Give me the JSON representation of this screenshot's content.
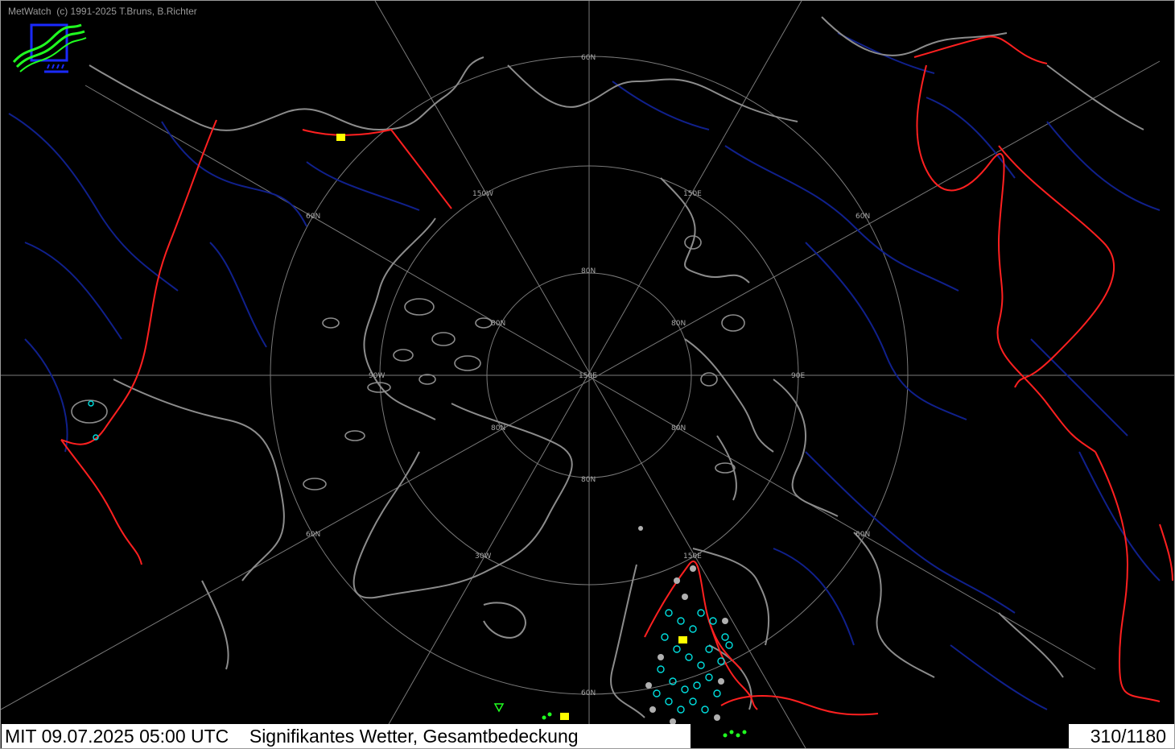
{
  "app": {
    "copyright": "MetWatch  (c) 1991-2025 T.Bruns, B.Richter",
    "logo_icon": "metwatch-logo-icon"
  },
  "footer": {
    "valid_time": "MIT 09.07.2025 05:00 UTC",
    "product": "Signifikantes Wetter, Gesamtbedeckung",
    "station_count": "310/1180"
  },
  "map": {
    "projection": "polar-stereographic",
    "grid_labels": {
      "lat_60n": "60N",
      "lat_80n": "80N",
      "lon_150w": "150W",
      "lon_150e": "150E",
      "lon_90w": "90W",
      "lon_90e": "90E",
      "lon_30w": "30W",
      "pole": "150E"
    },
    "colors": {
      "background": "#000000",
      "coastline": "#8c8c8c",
      "rivers": "#10208c",
      "borders": "#ff2020",
      "graticule": "#7a7a7a",
      "station_cloud": "#00e0e0",
      "station_overcast": "#b0b0b0",
      "weather_symbol": "#ffff00",
      "precipitation": "#20ff20"
    }
  }
}
